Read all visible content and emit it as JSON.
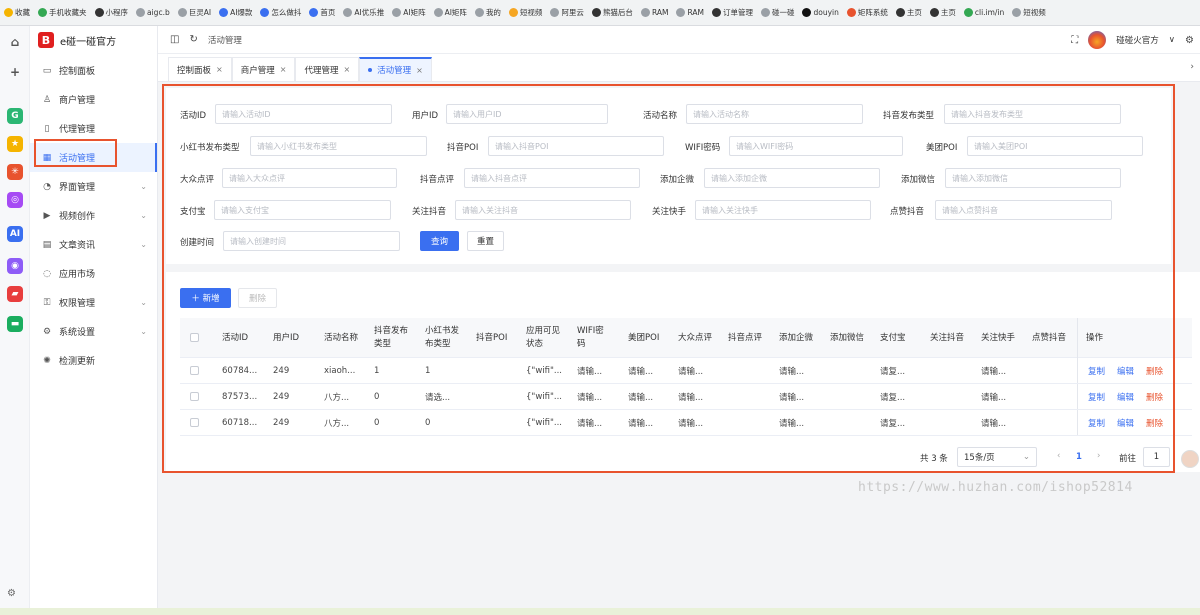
{
  "bookmarks": [
    {
      "label": "收藏",
      "color": "#f5b400"
    },
    {
      "label": "手机收藏夹",
      "color": "#34a853"
    },
    {
      "label": "小程序",
      "color": "#333333"
    },
    {
      "label": "aigc.b",
      "color": "#9aa0a6"
    },
    {
      "label": "巨灵AI",
      "color": "#9aa0a6"
    },
    {
      "label": "AI爆款",
      "color": "#3a6ff0"
    },
    {
      "label": "怎么做抖",
      "color": "#3a6ff0"
    },
    {
      "label": "首页",
      "color": "#3a6ff0"
    },
    {
      "label": "AI优乐推",
      "color": "#9aa0a6"
    },
    {
      "label": "AI矩阵",
      "color": "#9aa0a6"
    },
    {
      "label": "AI矩阵",
      "color": "#9aa0a6"
    },
    {
      "label": "我的",
      "color": "#9aa0a6"
    },
    {
      "label": "短视频",
      "color": "#f5a623"
    },
    {
      "label": "阿里云",
      "color": "#9aa0a6"
    },
    {
      "label": "熊猫后台",
      "color": "#333333"
    },
    {
      "label": "RAM",
      "color": "#9aa0a6"
    },
    {
      "label": "RAM",
      "color": "#9aa0a6"
    },
    {
      "label": "订单管理",
      "color": "#333333"
    },
    {
      "label": "碰一碰",
      "color": "#9aa0a6"
    },
    {
      "label": "douyin",
      "color": "#111111"
    },
    {
      "label": "矩阵系统",
      "color": "#e8532e"
    },
    {
      "label": "主页",
      "color": "#333333"
    },
    {
      "label": "主页",
      "color": "#333333"
    },
    {
      "label": "cli.im/in",
      "color": "#34a853"
    },
    {
      "label": "短视频",
      "color": "#9aa0a6"
    }
  ],
  "app": {
    "brand": "e碰一碰官方",
    "brand_icon": "B",
    "user_name": "碰碰火官方",
    "user_caret": "∨",
    "breadcrumb": "活动管理",
    "accent_color": "#3a6ff0",
    "danger_color": "#e8532e"
  },
  "icon_strip": [
    {
      "name": "home-icon",
      "glyph": "⌂",
      "color": "#ffffff"
    },
    {
      "name": "add-icon",
      "glyph": "+",
      "color": "#ffffff"
    },
    {
      "name": "app-green-icon",
      "glyph": "G",
      "color": "#2bb673"
    },
    {
      "name": "app-star-icon",
      "glyph": "★",
      "color": "#f5b400"
    },
    {
      "name": "app-dots-icon",
      "glyph": "✳",
      "color": "#e8532e"
    },
    {
      "name": "app-ring-icon",
      "glyph": "◎",
      "color": "#a64bf4"
    },
    {
      "name": "app-ai-icon",
      "glyph": "AI",
      "color": "#3a6ff0"
    },
    {
      "name": "app-eye-icon",
      "glyph": "◉",
      "color": "#8e5cf7"
    },
    {
      "name": "app-game-icon",
      "glyph": "▰",
      "color": "#e83e3e"
    },
    {
      "name": "app-mail-icon",
      "glyph": "▬",
      "color": "#1aad5f"
    }
  ],
  "sidebar": {
    "items": [
      {
        "label": "控制面板",
        "icon": "▭",
        "has_children": false
      },
      {
        "label": "商户管理",
        "icon": "♙",
        "has_children": false
      },
      {
        "label": "代理管理",
        "icon": "▯",
        "has_children": false
      },
      {
        "label": "活动管理",
        "icon": "▦",
        "has_children": false,
        "active": true
      },
      {
        "label": "界面管理",
        "icon": "◔",
        "has_children": true
      },
      {
        "label": "视频创作",
        "icon": "▶",
        "has_children": true
      },
      {
        "label": "文章资讯",
        "icon": "▤",
        "has_children": true
      },
      {
        "label": "应用市场",
        "icon": "◌",
        "has_children": false
      },
      {
        "label": "权限管理",
        "icon": "⚿",
        "has_children": true
      },
      {
        "label": "系统设置",
        "icon": "⚙",
        "has_children": true
      },
      {
        "label": "检测更新",
        "icon": "✺",
        "has_children": false
      }
    ]
  },
  "tabs": [
    {
      "label": "控制面板",
      "close": "×"
    },
    {
      "label": "商户管理",
      "close": "×"
    },
    {
      "label": "代理管理",
      "close": "×"
    },
    {
      "label": "活动管理",
      "close": "×",
      "active": true
    }
  ],
  "filters": [
    {
      "label": "活动ID",
      "placeholder": "请输入活动ID"
    },
    {
      "label": "用户ID",
      "placeholder": "请输入用户ID"
    },
    {
      "label": "活动名称",
      "placeholder": "请输入活动名称"
    },
    {
      "label": "抖音发布类型",
      "placeholder": "请输入抖音发布类型"
    },
    {
      "label": "小红书发布类型",
      "placeholder": "请输入小红书发布类型"
    },
    {
      "label": "抖音POI",
      "placeholder": "请输入抖音POI"
    },
    {
      "label": "WIFI密码",
      "placeholder": "请输入WIFI密码"
    },
    {
      "label": "美团POI",
      "placeholder": "请输入美团POI"
    },
    {
      "label": "大众点评",
      "placeholder": "请输入大众点评"
    },
    {
      "label": "抖音点评",
      "placeholder": "请输入抖音点评"
    },
    {
      "label": "添加企微",
      "placeholder": "请输入添加企微"
    },
    {
      "label": "添加微信",
      "placeholder": "请输入添加微信"
    },
    {
      "label": "支付宝",
      "placeholder": "请输入支付宝"
    },
    {
      "label": "关注抖音",
      "placeholder": "请输入关注抖音"
    },
    {
      "label": "关注快手",
      "placeholder": "请输入关注快手"
    },
    {
      "label": "点赞抖音",
      "placeholder": "请输入点赞抖音"
    },
    {
      "label": "创建时间",
      "placeholder": "请输入创建时间"
    }
  ],
  "buttons": {
    "search": "查询",
    "reset": "重置",
    "add": "＋ 新增",
    "delete": "删除"
  },
  "table": {
    "headers": [
      "活动ID",
      "用户ID",
      "活动名称",
      "抖音发布\n类型",
      "小红书发\n布类型",
      "抖音POI",
      "应用可见\n状态",
      "WIFI密\n码",
      "美团POI",
      "大众点评",
      "抖音点评",
      "添加企微",
      "添加微信",
      "支付宝",
      "关注抖音",
      "关注快手",
      "点赞抖音",
      "操作"
    ],
    "rows": [
      [
        "60784...",
        "249",
        "xiaoh...",
        "1",
        "1",
        "",
        "{\"wifi\"...",
        "请输...",
        "请输...",
        "请输...",
        "",
        "请输...",
        "",
        "请复...",
        "",
        "请输...",
        ""
      ],
      [
        "87573...",
        "249",
        "八方...",
        "0",
        "请选...",
        "",
        "{\"wifi\"...",
        "请输...",
        "请输...",
        "请输...",
        "",
        "请输...",
        "",
        "请复...",
        "",
        "请输...",
        ""
      ],
      [
        "60718...",
        "249",
        "八方...",
        "0",
        "0",
        "",
        "{\"wifi\"...",
        "请输...",
        "请输...",
        "请输...",
        "",
        "请输...",
        "",
        "请复...",
        "",
        "请输...",
        ""
      ]
    ],
    "actions": {
      "copy": "复制",
      "edit": "编辑",
      "delete": "删除"
    }
  },
  "pagination": {
    "total": "共 3 条",
    "page_size": "15条/页",
    "prev": "‹",
    "current_page": "1",
    "next": "›",
    "goto_label": "前往",
    "goto_value": "1"
  },
  "watermark": "https://www.huzhan.com/ishop52814"
}
